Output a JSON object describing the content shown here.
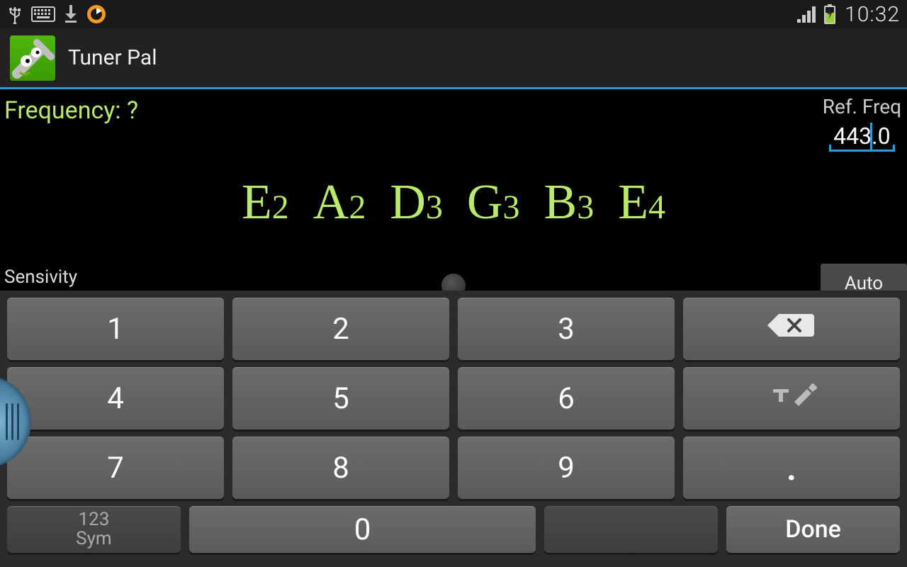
{
  "statusbar": {
    "time": "10:32"
  },
  "actionbar": {
    "title": "Tuner Pal"
  },
  "main": {
    "frequency_label": "Frequency: ?",
    "ref_label": "Ref. Freq",
    "ref_value": "443.0",
    "sensitivity_label": "Sensivity",
    "auto_label": "Auto",
    "notes": [
      {
        "n": "E",
        "o": "2"
      },
      {
        "n": "A",
        "o": "2"
      },
      {
        "n": "D",
        "o": "3"
      },
      {
        "n": "G",
        "o": "3"
      },
      {
        "n": "B",
        "o": "3"
      },
      {
        "n": "E",
        "o": "4"
      }
    ]
  },
  "keyboard": {
    "k1": "1",
    "k2": "2",
    "k3": "3",
    "k4": "4",
    "k5": "5",
    "k6": "6",
    "k7": "7",
    "k8": "8",
    "k9": "9",
    "k0": "0",
    "sym_top": "123",
    "sym_bot": "Sym",
    "dot": ".",
    "done": "Done"
  }
}
